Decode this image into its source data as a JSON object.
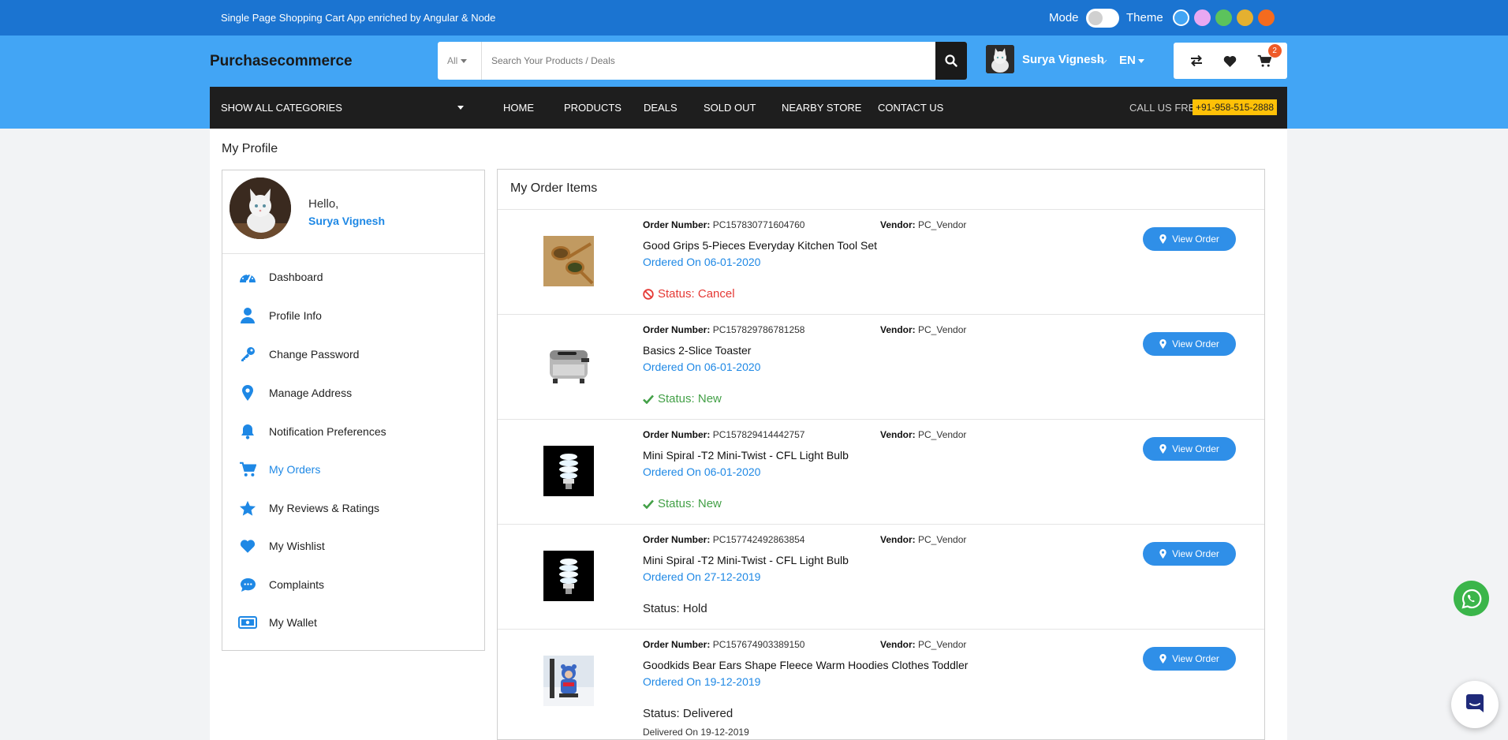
{
  "topbar": {
    "tagline": "Single Page Shopping Cart App enriched by Angular & Node",
    "mode_label": "Mode",
    "theme_label": "Theme",
    "theme_colors": [
      "#42a5f5",
      "#e9a8f2",
      "#5cc35c",
      "#e4b030",
      "#f46b1e"
    ]
  },
  "header": {
    "logo": "Purchasecommerce",
    "search": {
      "category": "All",
      "placeholder": "Search Your Products / Deals"
    },
    "user_name": "Surya Vignesh",
    "language": "EN",
    "cart_count": "2"
  },
  "nav": {
    "categories_label": "SHOW ALL CATEGORIES",
    "links": [
      "HOME",
      "PRODUCTS",
      "DEALS",
      "SOLD OUT",
      "NEARBY STORE",
      "CONTACT US"
    ],
    "call_label": "CALL US FREE:",
    "phone": "+91-958-515-2888"
  },
  "profile": {
    "page_title": "My Profile",
    "hello": "Hello,",
    "user_name": "Surya Vignesh",
    "menu": [
      {
        "label": "Dashboard",
        "icon": "dashboard-icon"
      },
      {
        "label": "Profile Info",
        "icon": "user-icon"
      },
      {
        "label": "Change Password",
        "icon": "key-icon"
      },
      {
        "label": "Manage Address",
        "icon": "map-marker-icon"
      },
      {
        "label": "Notification Preferences",
        "icon": "bell-icon"
      },
      {
        "label": "My Orders",
        "icon": "cart-icon",
        "active": true
      },
      {
        "label": "My Reviews & Ratings",
        "icon": "star-icon"
      },
      {
        "label": "My Wishlist",
        "icon": "heart-icon"
      },
      {
        "label": "Complaints",
        "icon": "chat-bubble-icon"
      },
      {
        "label": "My Wallet",
        "icon": "wallet-icon"
      }
    ]
  },
  "orders": {
    "title": "My Order Items",
    "order_number_label": "Order Number:",
    "vendor_label": "Vendor:",
    "view_button": "View Order",
    "items": [
      {
        "order_number": "PC157830771604760",
        "vendor": "PC_Vendor",
        "product": "Good Grips 5-Pieces Everyday Kitchen Tool Set",
        "ordered_on": "Ordered On 06-01-2020",
        "status": "Status: Cancel",
        "status_color": "#e53935"
      },
      {
        "order_number": "PC157829786781258",
        "vendor": "PC_Vendor",
        "product": "Basics 2-Slice Toaster",
        "ordered_on": "Ordered On 06-01-2020",
        "status": "Status: New",
        "status_color": "#43a047"
      },
      {
        "order_number": "PC157829414442757",
        "vendor": "PC_Vendor",
        "product": "Mini Spiral -T2 Mini-Twist - CFL Light Bulb",
        "ordered_on": "Ordered On 06-01-2020",
        "status": "Status: New",
        "status_color": "#43a047"
      },
      {
        "order_number": "PC157742492863854",
        "vendor": "PC_Vendor",
        "product": "Mini Spiral -T2 Mini-Twist - CFL Light Bulb",
        "ordered_on": "Ordered On 27-12-2019",
        "status": "Status: Hold",
        "status_color": "#222222"
      },
      {
        "order_number": "PC157674903389150",
        "vendor": "PC_Vendor",
        "product": "Goodkids Bear Ears Shape Fleece Warm Hoodies Clothes Toddler",
        "ordered_on": "Ordered On 19-12-2019",
        "status": "Status: Delivered",
        "status_color": "#222222",
        "delivered_on": "Delivered On 19-12-2019"
      }
    ]
  }
}
